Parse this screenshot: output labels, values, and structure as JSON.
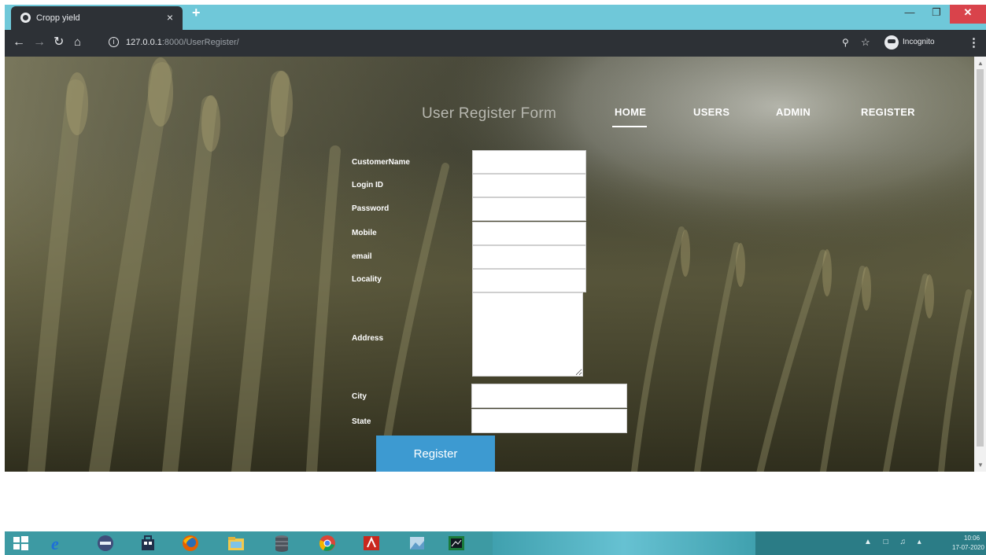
{
  "browser": {
    "tab_title": "Cropp yield",
    "tab_close": "×",
    "new_tab": "+",
    "url_host": "127.0.0.1",
    "url_rest": ":8000/UserRegister/",
    "profile_label": "Incognito",
    "chrome_color": "#2d3136",
    "tabstrip_color": "#6fc8d9"
  },
  "site": {
    "title": "User Register Form",
    "nav": {
      "home": "HOME",
      "users": "USERS",
      "admin": "ADMIN",
      "register": "REGISTER"
    }
  },
  "form": {
    "fields": {
      "customer_name": "CustomerName",
      "login_id": "Login ID",
      "password": "Password",
      "mobile": "Mobile",
      "email": "email",
      "locality": "Locality",
      "address": "Address",
      "city": "City",
      "state": "State"
    },
    "submit_label": "Register",
    "button_color": "#3d9ad1"
  },
  "taskbar": {
    "time": "10:06",
    "date": "17-07-2020",
    "color": "#3d9aa3"
  }
}
